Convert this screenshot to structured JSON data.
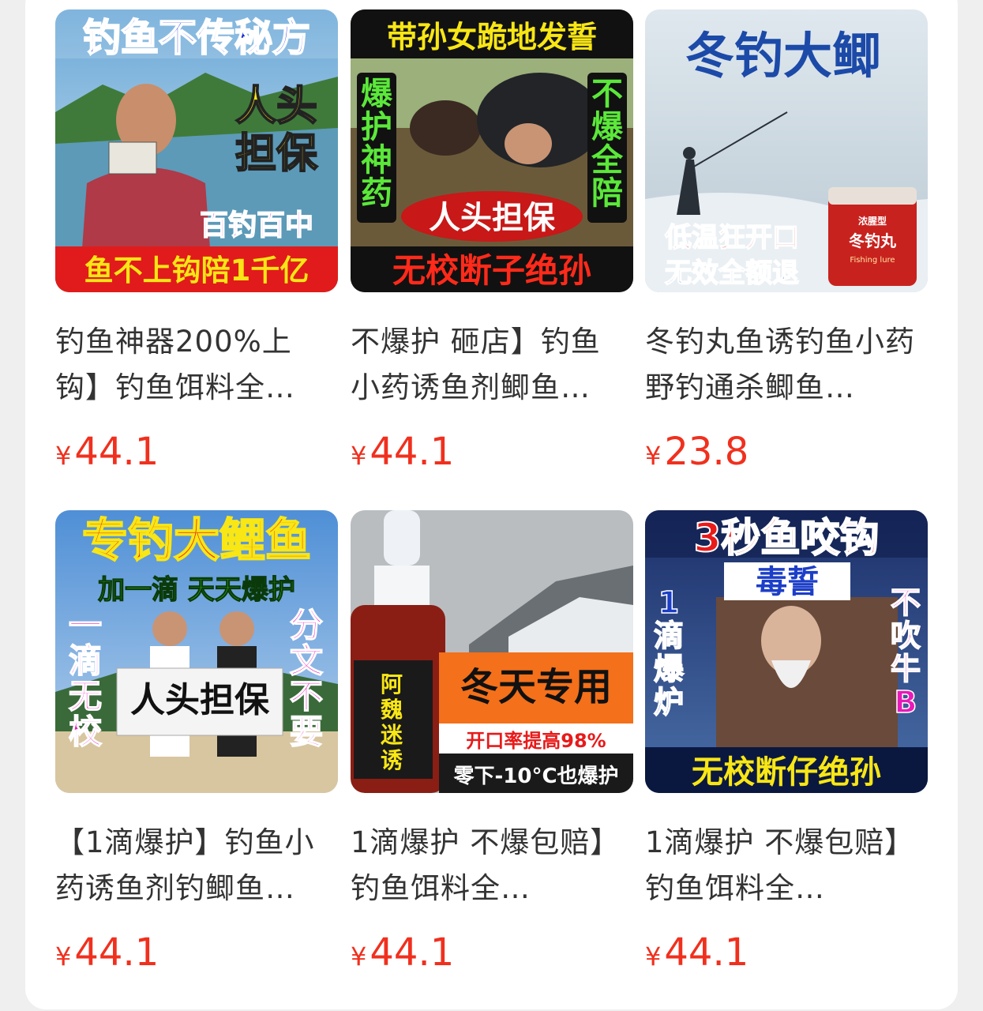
{
  "products": [
    {
      "title": "钓鱼神器200%上钩】钓鱼饵料全…",
      "currency": "¥",
      "price": "44.1",
      "image_text": [
        "钓鱼不传秘方",
        "人头",
        "担保",
        "百钓百中",
        "鱼不上钩陪1千亿"
      ]
    },
    {
      "title": "不爆护 砸店】钓鱼小药诱鱼剂鲫鱼…",
      "currency": "¥",
      "price": "44.1",
      "image_text": [
        "带孙女跪地发誓",
        "爆护神药",
        "不爆全陪",
        "人头担保",
        "无校断子绝孙"
      ]
    },
    {
      "title": "冬钓丸鱼诱钓鱼小药野钓通杀鲫鱼…",
      "currency": "¥",
      "price": "23.8",
      "image_text": [
        "冬钓大鲫",
        "低温狂开口",
        "无效全额退",
        "浓腥型",
        "冬钓丸",
        "Fishing lure"
      ]
    },
    {
      "title": "【1滴爆护】钓鱼小药诱鱼剂钓鲫鱼…",
      "currency": "¥",
      "price": "44.1",
      "image_text": [
        "专钓大鲤鱼",
        "加一滴 天天爆护",
        "一滴无校",
        "分文不要",
        "人头担保"
      ]
    },
    {
      "title": "1滴爆护 不爆包赔】钓鱼饵料全…",
      "currency": "¥",
      "price": "44.1",
      "image_text": [
        "冬天专用",
        "开口率提高98%",
        "零下-10°C也爆护",
        "阿魏迷诱"
      ]
    },
    {
      "title": "1滴爆护 不爆包赔】钓鱼饵料全…",
      "currency": "¥",
      "price": "44.1",
      "image_text": [
        "3秒鱼咬钩",
        "毒誓",
        "1滴爆炉",
        "不吹牛B",
        "无校断仔绝孙"
      ]
    }
  ],
  "colors": {
    "price": "#f0301e",
    "title": "#333333",
    "card_bg": "#ffffff",
    "page_bg": "#efefef"
  }
}
